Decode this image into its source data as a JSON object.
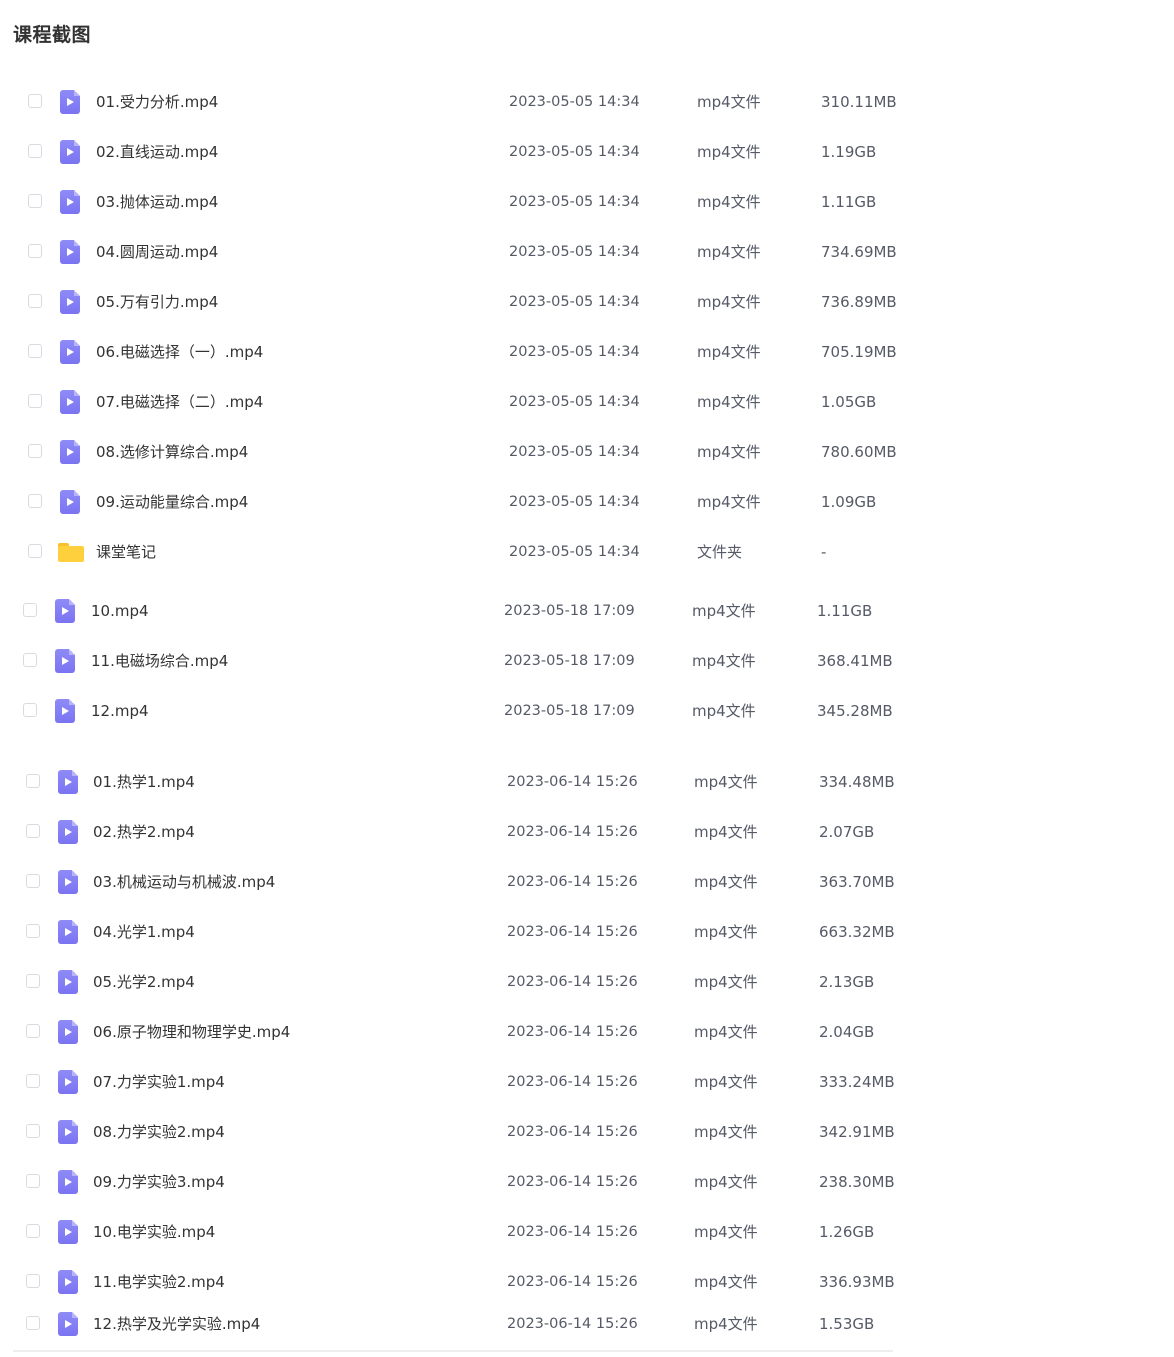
{
  "title": "课程截图",
  "colors": {
    "video_icon": "#7b74f2",
    "folder_icon": "#ffd03d",
    "text": "#333333",
    "muted_text": "#555a66"
  },
  "groups": [
    {
      "items": [
        {
          "name": "01.受力分析.mp4",
          "date": "2023-05-05 14:34",
          "type": "mp4文件",
          "size": "310.11MB",
          "icon": "video-file-icon"
        },
        {
          "name": "02.直线运动.mp4",
          "date": "2023-05-05 14:34",
          "type": "mp4文件",
          "size": "1.19GB",
          "icon": "video-file-icon"
        },
        {
          "name": "03.抛体运动.mp4",
          "date": "2023-05-05 14:34",
          "type": "mp4文件",
          "size": "1.11GB",
          "icon": "video-file-icon"
        },
        {
          "name": "04.圆周运动.mp4",
          "date": "2023-05-05 14:34",
          "type": "mp4文件",
          "size": "734.69MB",
          "icon": "video-file-icon"
        },
        {
          "name": "05.万有引力.mp4",
          "date": "2023-05-05 14:34",
          "type": "mp4文件",
          "size": "736.89MB",
          "icon": "video-file-icon"
        },
        {
          "name": "06.电磁选择（一）.mp4",
          "date": "2023-05-05 14:34",
          "type": "mp4文件",
          "size": "705.19MB",
          "icon": "video-file-icon"
        },
        {
          "name": "07.电磁选择（二）.mp4",
          "date": "2023-05-05 14:34",
          "type": "mp4文件",
          "size": "1.05GB",
          "icon": "video-file-icon"
        },
        {
          "name": "08.选修计算综合.mp4",
          "date": "2023-05-05 14:34",
          "type": "mp4文件",
          "size": "780.60MB",
          "icon": "video-file-icon"
        },
        {
          "name": "09.运动能量综合.mp4",
          "date": "2023-05-05 14:34",
          "type": "mp4文件",
          "size": "1.09GB",
          "icon": "video-file-icon"
        },
        {
          "name": "课堂笔记",
          "date": "2023-05-05 14:34",
          "type": "文件夹",
          "size": "-",
          "icon": "folder-icon"
        }
      ]
    },
    {
      "items": [
        {
          "name": "10.mp4",
          "date": "2023-05-18 17:09",
          "type": "mp4文件",
          "size": "1.11GB",
          "icon": "video-file-icon"
        },
        {
          "name": "11.电磁场综合.mp4",
          "date": "2023-05-18 17:09",
          "type": "mp4文件",
          "size": "368.41MB",
          "icon": "video-file-icon"
        },
        {
          "name": "12.mp4",
          "date": "2023-05-18 17:09",
          "type": "mp4文件",
          "size": "345.28MB",
          "icon": "video-file-icon"
        }
      ]
    },
    {
      "items": [
        {
          "name": "01.热学1.mp4",
          "date": "2023-06-14 15:26",
          "type": "mp4文件",
          "size": "334.48MB",
          "icon": "video-file-icon"
        },
        {
          "name": "02.热学2.mp4",
          "date": "2023-06-14 15:26",
          "type": "mp4文件",
          "size": "2.07GB",
          "icon": "video-file-icon"
        },
        {
          "name": "03.机械运动与机械波.mp4",
          "date": "2023-06-14 15:26",
          "type": "mp4文件",
          "size": "363.70MB",
          "icon": "video-file-icon"
        },
        {
          "name": "04.光学1.mp4",
          "date": "2023-06-14 15:26",
          "type": "mp4文件",
          "size": "663.32MB",
          "icon": "video-file-icon"
        },
        {
          "name": "05.光学2.mp4",
          "date": "2023-06-14 15:26",
          "type": "mp4文件",
          "size": "2.13GB",
          "icon": "video-file-icon"
        },
        {
          "name": "06.原子物理和物理学史.mp4",
          "date": "2023-06-14 15:26",
          "type": "mp4文件",
          "size": "2.04GB",
          "icon": "video-file-icon"
        },
        {
          "name": "07.力学实验1.mp4",
          "date": "2023-06-14 15:26",
          "type": "mp4文件",
          "size": "333.24MB",
          "icon": "video-file-icon"
        },
        {
          "name": "08.力学实验2.mp4",
          "date": "2023-06-14 15:26",
          "type": "mp4文件",
          "size": "342.91MB",
          "icon": "video-file-icon"
        },
        {
          "name": "09.力学实验3.mp4",
          "date": "2023-06-14 15:26",
          "type": "mp4文件",
          "size": "238.30MB",
          "icon": "video-file-icon"
        },
        {
          "name": "10.电学实验.mp4",
          "date": "2023-06-14 15:26",
          "type": "mp4文件",
          "size": "1.26GB",
          "icon": "video-file-icon"
        },
        {
          "name": "11.电学实验2.mp4",
          "date": "2023-06-14 15:26",
          "type": "mp4文件",
          "size": "336.93MB",
          "icon": "video-file-icon"
        },
        {
          "name": "12.热学及光学实验.mp4",
          "date": "2023-06-14 15:26",
          "type": "mp4文件",
          "size": "1.53GB",
          "icon": "video-file-icon"
        }
      ]
    }
  ]
}
